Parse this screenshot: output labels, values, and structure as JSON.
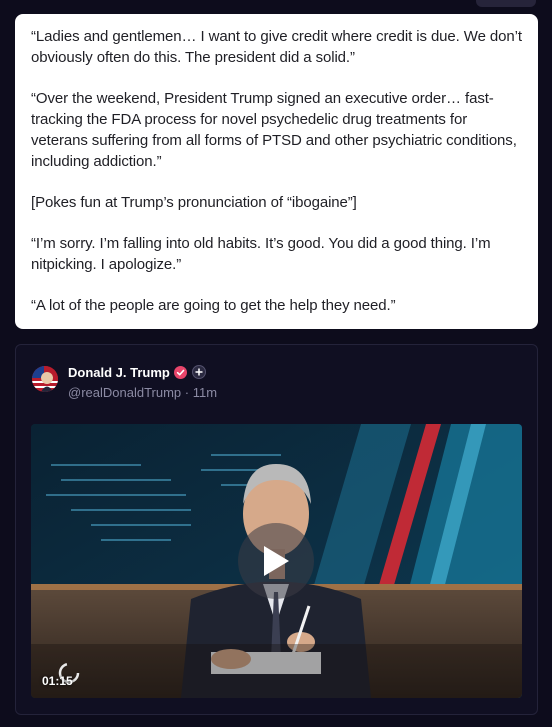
{
  "quote": {
    "paragraphs": [
      "“Ladies and gentlemen… I want to give credit where credit is due. We don’t obviously often do this. The president did a solid.”",
      "“Over the weekend, President Trump signed an executive order… fast-tracking the FDA process for novel psychedelic drug treatments for veterans suffering from all forms of PTSD and other psychiatric conditions, including addiction.”",
      "[Pokes fun at Trump’s pronunciation of “ibogaine”]",
      "“I’m sorry. I’m falling into old habits. It’s good. You did a good thing. I’m nitpicking. I apologize.”",
      "“A lot of the people are going to get the help they need.”"
    ]
  },
  "post": {
    "author_name": "Donald J. Trump",
    "handle": "@realDonaldTrump",
    "separator": "·",
    "time": "11m",
    "icons": [
      "verified-badge-icon",
      "plus-icon",
      "play-icon",
      "loading-icon"
    ]
  },
  "video": {
    "duration": "01:15"
  },
  "colors": {
    "background": "#0d0c1c",
    "card": "#ffffff",
    "verified": "#e8456b"
  }
}
